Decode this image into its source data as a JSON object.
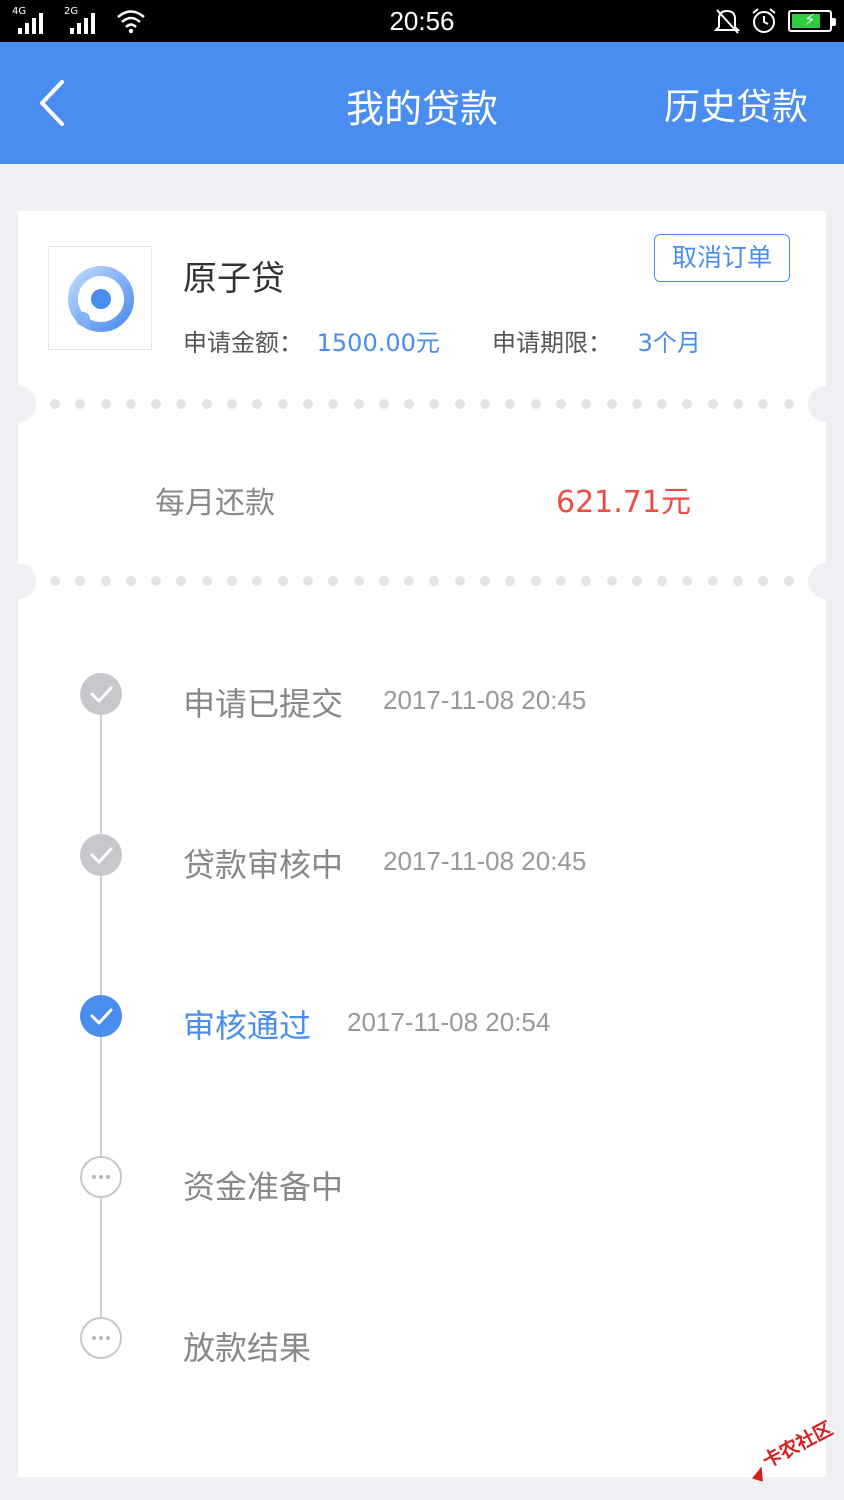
{
  "status_bar": {
    "network_1": "4G",
    "network_2": "2G",
    "time": "20:56",
    "icons": [
      "signal-icon",
      "wifi-icon",
      "bell-muted-icon",
      "alarm-icon",
      "battery-charging-icon"
    ]
  },
  "header": {
    "back_icon": "chevron-left-icon",
    "title": "我的贷款",
    "history_label": "历史贷款",
    "background_color": "#4a8df0"
  },
  "loan": {
    "logo_icon": "yuanzidai-logo",
    "name": "原子贷",
    "cancel_label": "取消订单",
    "amount_label": "申请金额：",
    "amount_value": "1500.00元",
    "term_label": "申请期限：",
    "term_value": "3个月",
    "monthly_label": "每月还款",
    "monthly_value": "621.71元",
    "monthly_value_color": "#f04a45"
  },
  "timeline": [
    {
      "title": "申请已提交",
      "time": "2017-11-08 20:45",
      "state": "done"
    },
    {
      "title": "贷款审核中",
      "time": "2017-11-08 20:45",
      "state": "done"
    },
    {
      "title": "审核通过",
      "time": "2017-11-08 20:54",
      "state": "active"
    },
    {
      "title": "资金准备中",
      "time": "",
      "state": "pending"
    },
    {
      "title": "放款结果",
      "time": "",
      "state": "pending"
    }
  ],
  "watermark": {
    "text": "卡农社区",
    "icon": "kanong-logo-icon"
  }
}
